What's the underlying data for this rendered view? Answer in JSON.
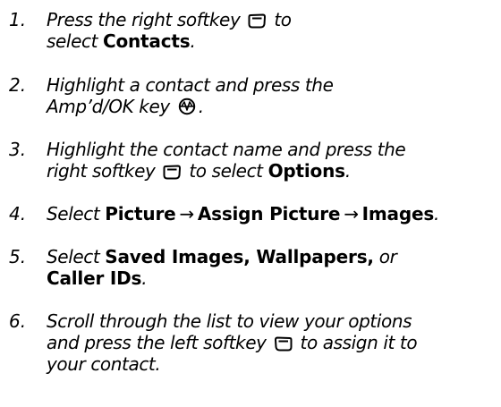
{
  "steps": [
    {
      "number": "1.",
      "line1_text": "Press the right softkey",
      "line1_after_icon": "to",
      "line2_prefix": "select",
      "line2_bold": "Contacts",
      "line2_suffix": ".",
      "icon": "right-softkey-icon"
    },
    {
      "number": "2.",
      "line1": "Highlight a contact and press the",
      "line2_text": "Amp’d/OK key",
      "line2_suffix": ".",
      "icon": "amp-ok-key-icon"
    },
    {
      "number": "3.",
      "line1": "Highlight the contact name and press the",
      "line2_text": "right softkey",
      "line2_mid": "to select",
      "line2_bold": "Options",
      "line2_suffix": ".",
      "icon": "right-softkey-icon"
    },
    {
      "number": "4.",
      "prefix": "Select",
      "bold1": "Picture",
      "arrow1": "→",
      "bold2": "Assign Picture",
      "arrow2": "→",
      "bold3": "Images",
      "suffix": "."
    },
    {
      "number": "5.",
      "prefix": "Select",
      "bold1": "Saved Images, Wallpapers,",
      "mid": "or",
      "bold2": "Caller IDs",
      "suffix": "."
    },
    {
      "number": "6.",
      "line1": "Scroll through the list to view your options",
      "line2_text": "and press the left softkey",
      "line2_after_icon": "to assign it to",
      "line3": "your contact.",
      "icon": "left-softkey-icon"
    }
  ]
}
